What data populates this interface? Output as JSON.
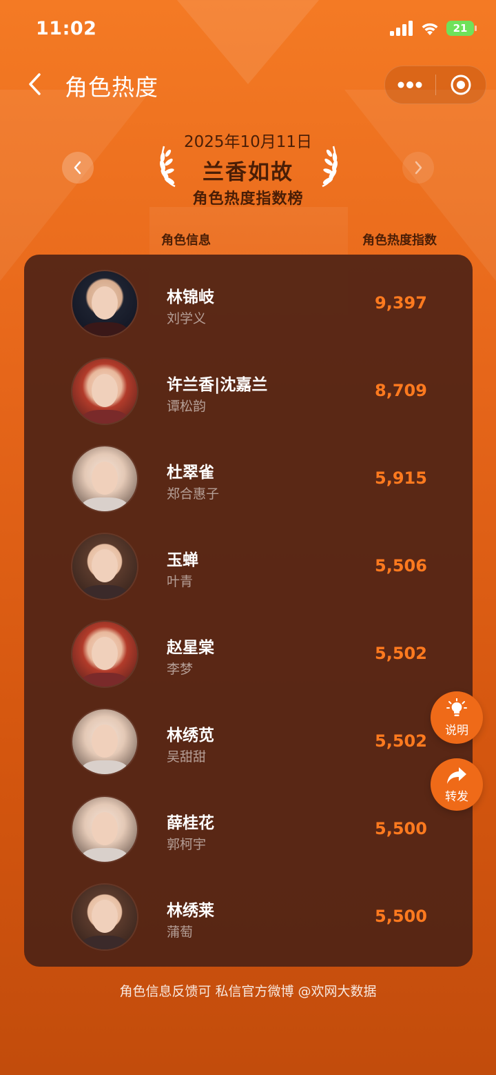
{
  "status_bar": {
    "time": "11:02",
    "battery": "21",
    "icons": [
      "signal-icon",
      "wifi-icon",
      "battery-icon"
    ]
  },
  "nav": {
    "title": "角色热度",
    "back_icon": "chevron-left-icon",
    "more_icon": "more-dots-icon",
    "close_icon": "target-circle-icon"
  },
  "header": {
    "date": "2025年10月11日",
    "show": "兰香如故",
    "subtitle": "角色热度指数榜"
  },
  "columns": {
    "left": "角色信息",
    "right": "角色热度指数"
  },
  "rankings": [
    {
      "character": "林锦岐",
      "actor": "刘学义",
      "heat": "9,397"
    },
    {
      "character": "许兰香|沈嘉兰",
      "actor": "谭松韵",
      "heat": "8,709"
    },
    {
      "character": "杜翠雀",
      "actor": "郑合惠子",
      "heat": "5,915"
    },
    {
      "character": "玉蝉",
      "actor": "叶青",
      "heat": "5,506"
    },
    {
      "character": "赵星棠",
      "actor": "李梦",
      "heat": "5,502"
    },
    {
      "character": "林绣苋",
      "actor": "吴甜甜",
      "heat": "5,502"
    },
    {
      "character": "薛桂花",
      "actor": "郭柯宇",
      "heat": "5,500"
    },
    {
      "character": "林绣莱",
      "actor": "蒲萄",
      "heat": "5,500"
    }
  ],
  "float_buttons": {
    "explain": "说明",
    "share": "转发"
  },
  "footer": {
    "note": "角色信息反馈可 私信官方微博 @欢网大数据"
  },
  "colors": {
    "accent": "#ff7a1f",
    "card": "#502416",
    "header_text": "#4a1e06"
  }
}
